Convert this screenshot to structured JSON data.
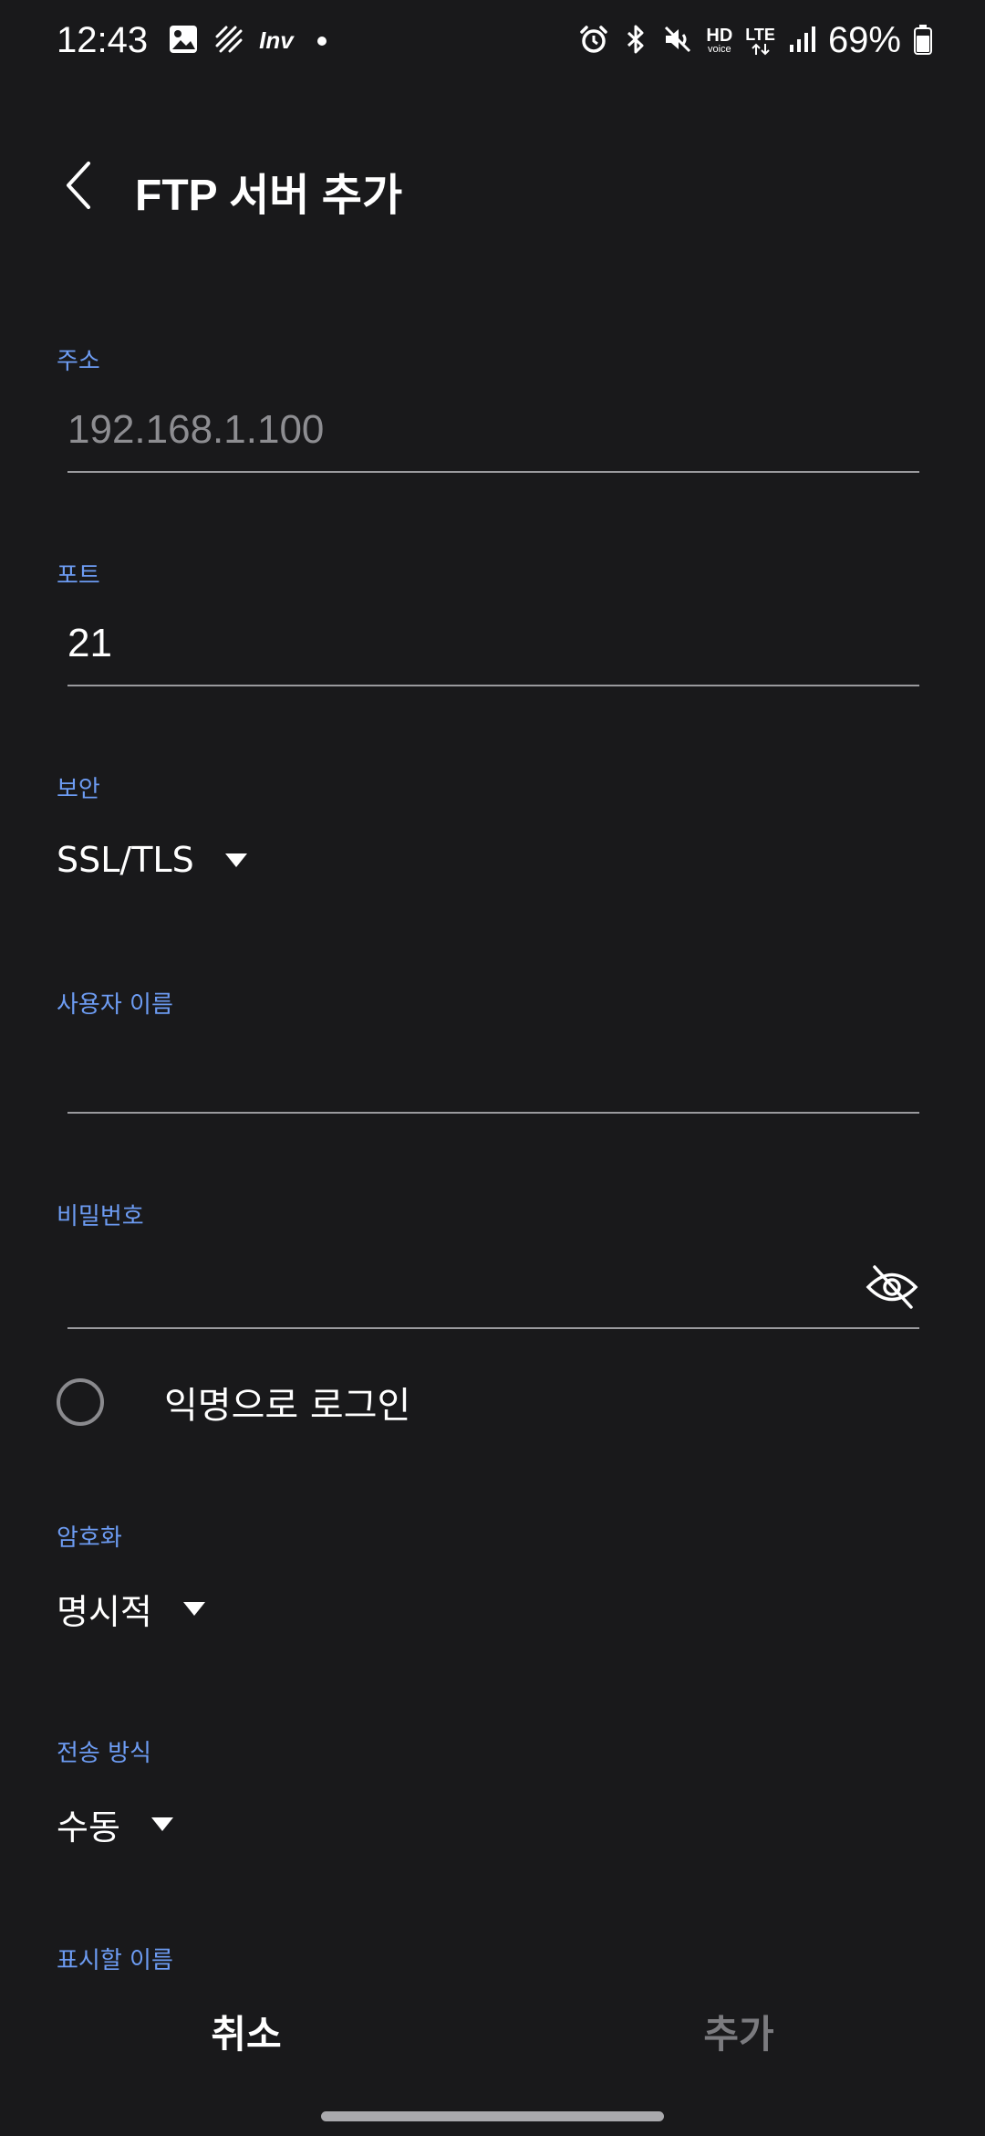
{
  "status_bar": {
    "time": "12:43",
    "inv_label": "Inv",
    "hd_label": "HD",
    "voice_label": "voice",
    "lte_label": "LTE",
    "battery_percent": "69%",
    "icons": [
      "gallery-icon",
      "data-saver-icon",
      "inv-icon",
      "notification-dot-icon",
      "alarm-icon",
      "bluetooth-icon",
      "mute-icon",
      "hd-voice-icon",
      "lte-icon",
      "signal-icon",
      "battery-icon"
    ]
  },
  "header": {
    "title": "FTP 서버 추가",
    "back_icon": "chevron-left-icon"
  },
  "form": {
    "address": {
      "label": "주소",
      "placeholder": "192.168.1.100"
    },
    "port": {
      "label": "포트",
      "value": "21"
    },
    "security": {
      "label": "보안",
      "selected": "SSL/TLS"
    },
    "username": {
      "label": "사용자 이름",
      "value": ""
    },
    "password": {
      "label": "비밀번호",
      "value": "",
      "toggle_icon": "eye-off-icon"
    },
    "anonymous": {
      "label": "익명으로 로그인",
      "checked": false
    },
    "encryption": {
      "label": "암호화",
      "selected": "명시적"
    },
    "transfer_mode": {
      "label": "전송 방식",
      "selected": "수동"
    },
    "display_name": {
      "label": "표시할 이름"
    }
  },
  "actions": {
    "cancel_label": "취소",
    "add_label": "추가"
  },
  "colors": {
    "background": "#19191b",
    "label_accent": "#6d9cf3",
    "underline": "#9a9a9e",
    "disabled_text": "#7b7b7f"
  }
}
